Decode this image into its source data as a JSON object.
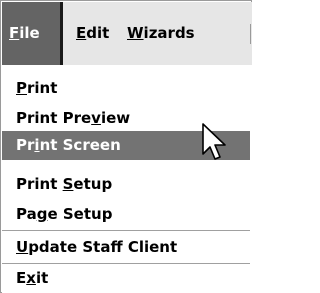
{
  "menubar": {
    "items": [
      {
        "label": "File",
        "mnemonic_index": 0
      },
      {
        "label": "Edit",
        "mnemonic_index": 0
      },
      {
        "label": "Wizards",
        "mnemonic_index": 0
      }
    ]
  },
  "file_menu": {
    "items": [
      {
        "label": "Print",
        "mnemonic_index": 0
      },
      {
        "label": "Print Preview",
        "mnemonic_index": 9
      },
      {
        "label": "Print Screen",
        "mnemonic_index": 2
      },
      {
        "label": "Print Setup",
        "mnemonic_index": 6
      },
      {
        "label": "Page Setup",
        "mnemonic_index": 2
      },
      {
        "label": "Update Staff Client",
        "mnemonic_index": 0
      },
      {
        "label": "Exit",
        "mnemonic_index": 1
      }
    ],
    "selected_label": "Print Screen"
  },
  "colors": {
    "active_menu": "#646464",
    "selected_item": "#737373",
    "menubar_bg": "#e6e6e6"
  },
  "cursor": {
    "icon": "arrow-pointer-icon"
  }
}
